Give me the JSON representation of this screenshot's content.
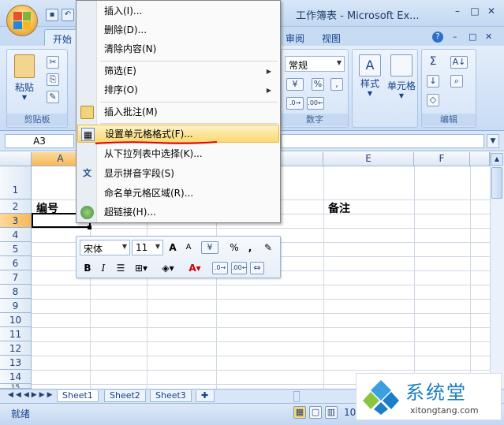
{
  "window": {
    "title": "工作簿表 - Microsoft Ex..."
  },
  "quick_access": {
    "save_icon": "save-icon",
    "undo_icon": "undo-icon"
  },
  "tabs": [
    {
      "label": "开始",
      "active": true
    },
    {
      "label": "审阅",
      "active": false
    },
    {
      "label": "视图",
      "active": false
    }
  ],
  "ribbon": {
    "clipboard": {
      "paste_label": "粘贴",
      "group_label": "剪贴板"
    },
    "number": {
      "format_value": "常规",
      "percent": "%",
      "comma": ",",
      "group_label": "数字"
    },
    "styles": {
      "label": "样式"
    },
    "cells": {
      "label": "单元格"
    },
    "editing": {
      "sum_label": "Σ",
      "group_label": "编辑"
    }
  },
  "formula_bar": {
    "name_box": "A3"
  },
  "columns": [
    "A",
    "E",
    "F"
  ],
  "rows": [
    "1",
    "2",
    "3",
    "4",
    "5",
    "6",
    "7",
    "8",
    "9",
    "10",
    "11",
    "12",
    "13",
    "14",
    "15"
  ],
  "cells": {
    "A2": "编号",
    "E2": "备注"
  },
  "context_menu": [
    {
      "label": "插入(I)...",
      "icon": ""
    },
    {
      "label": "删除(D)...",
      "icon": ""
    },
    {
      "label": "清除内容(N)",
      "icon": ""
    },
    {
      "label": "筛选(E)",
      "icon": "",
      "submenu": true
    },
    {
      "label": "排序(O)",
      "icon": "",
      "submenu": true
    },
    {
      "label": "插入批注(M)",
      "icon": "comment-icon"
    },
    {
      "label": "设置单元格格式(F)...",
      "icon": "format-cells-icon",
      "highlighted": true
    },
    {
      "label": "从下拉列表中选择(K)...",
      "icon": ""
    },
    {
      "label": "显示拼音字段(S)",
      "icon": "phonetic-icon"
    },
    {
      "label": "命名单元格区域(R)...",
      "icon": ""
    },
    {
      "label": "超链接(H)...",
      "icon": "hyperlink-icon"
    }
  ],
  "mini_toolbar": {
    "font": "宋体",
    "size": "11",
    "percent": "%",
    "comma": ","
  },
  "sheets": [
    {
      "label": "Sheet1",
      "active": true
    },
    {
      "label": "Sheet2",
      "active": false
    },
    {
      "label": "Sheet3",
      "active": false
    }
  ],
  "status": {
    "ready": "就绪",
    "zoom": "10"
  },
  "watermark": {
    "title": "系统堂",
    "url": "xitongtang.com"
  },
  "colors": {
    "accent": "#15428b",
    "highlight": "#fbd873",
    "annotation_red": "#e00000"
  }
}
